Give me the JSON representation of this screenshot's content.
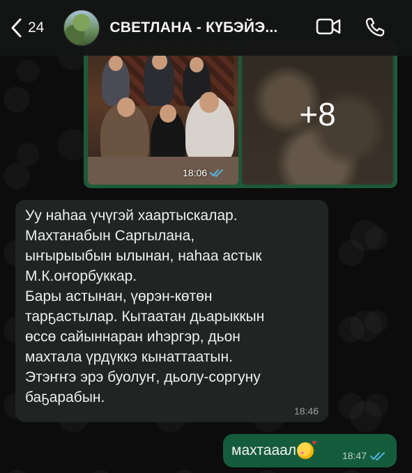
{
  "header": {
    "back_count": "24",
    "title": "СВЕТЛАНА - КҮБЭЙЭ...",
    "icons": [
      "chevron-left-icon",
      "video-call-icon",
      "phone-icon"
    ]
  },
  "media": {
    "time": "18:06",
    "more_count": "+8"
  },
  "incoming": {
    "lines": [
      "Уу наһаа үчүгэй хаартыскалар.",
      "Махтанабын Саргылана,",
      "ыҥырыыбын ылынан, наһаа астык",
      "М.К.оҥорбуккар.",
      "Бары астынан, үөрэн-көтөн",
      "тарҕастылар. Кытаатан дьарыккын",
      "өссө сайыннаран иһэргэр, дьон",
      "махтала үрдүккэ кынаттаатын.",
      "Этэҥҥэ эрэ буолуҥ, дьолу-соргуну",
      "баҕарабын."
    ],
    "time": "18:46"
  },
  "outgoing": {
    "text": "махтааал",
    "emoji": "smiling-face-with-hearts-icon",
    "time": "18:47"
  },
  "colors": {
    "accent_out": "#155c3c",
    "bubble_in": "#202422",
    "read_ticks": "#53bdeb"
  }
}
